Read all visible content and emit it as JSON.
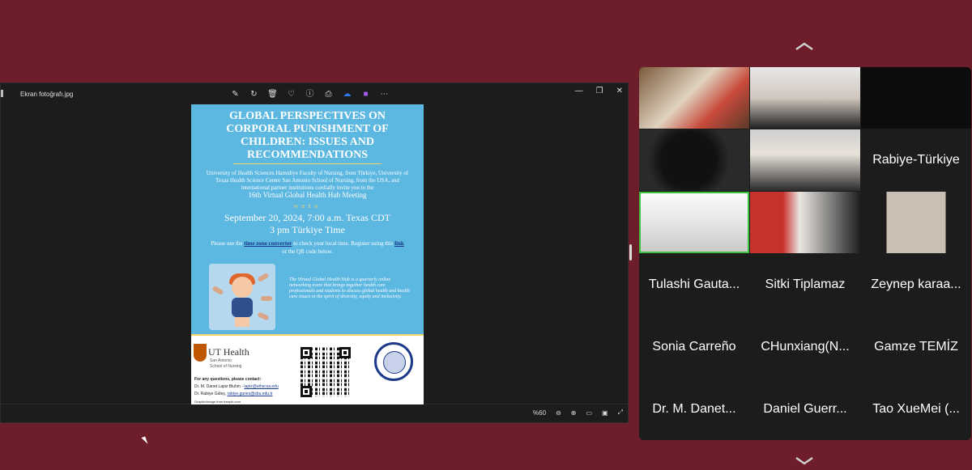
{
  "viewer": {
    "file_name": "Ekran fotoğrafı.jpg",
    "zoom": "%60",
    "toolbar_icons": [
      "edit-icon",
      "rotate-icon",
      "delete-icon",
      "favorite-icon",
      "info-icon",
      "print-icon",
      "onedrive-icon",
      "clipchamp-icon",
      "more-icon"
    ],
    "window_controls": [
      "minimize-icon",
      "maximize-icon",
      "close-icon"
    ]
  },
  "poster": {
    "title": "GLOBAL PERSPECTIVES ON CORPORAL PUNISHMENT OF CHILDREN: ISSUES AND RECOMMENDATIONS",
    "invite": "University of Health Sciences Hamidiye Faculty of Nursing, from Türkiye, University of Texas Health Science Center San Antonio School of Nursing, from the USA, and international partner institutions cordially invite you to the",
    "meeting": "16th Virtual Global Health Hub Meeting",
    "when": "WHEN",
    "date_line1": "September 20, 2024, 7:00 a.m. Texas CDT",
    "date_line2": "3 pm Türkiye Time",
    "note_pre": "Please use the",
    "note_link1": "time zone converter",
    "note_mid": "to check your local time. Register using this",
    "note_link2": "link",
    "note_post": "or the QR code below.",
    "hub_text": "The Virtual Global Health Hub is a quarterly online networking event that brings together health care professionals and students to discuss global health and health care issues in the spirit of diversity, equity and inclusivity.",
    "ut_name": "UT Health",
    "ut_sub1": "San Antonio",
    "ut_sub2": "School of Nursing",
    "contact_title": "For any questions, please contact:",
    "contact1_name": "Dr. M. Danet Lapiz Bluhm -",
    "contact1_email": "lapiz@uthscsa.edu",
    "contact2_name": "Dr. Rabiye Güleş,",
    "contact2_email": "rabiye.gunes@sbu.edu.tr",
    "credit": "Graphic/image from freepik.com"
  },
  "gallery": {
    "participants": [
      {
        "name": "",
        "video": true
      },
      {
        "name": "",
        "video": true
      },
      {
        "name": "",
        "video": true
      },
      {
        "name": "",
        "video": true
      },
      {
        "name": "",
        "video": true
      },
      {
        "name": "Rabiye-Türkiye",
        "video": false
      },
      {
        "name": "",
        "video": true
      },
      {
        "name": "",
        "video": true
      },
      {
        "name": "",
        "video": true
      },
      {
        "name": "Tulashi Gauta...",
        "video": false
      },
      {
        "name": "Sitki Tiplamaz",
        "video": false
      },
      {
        "name": "Zeynep karaa...",
        "video": false
      },
      {
        "name": "Sonia Carreño",
        "video": false
      },
      {
        "name": "CHunxiang(N...",
        "video": false
      },
      {
        "name": "Gamze TEMİZ",
        "video": false
      },
      {
        "name": "Dr. M. Danet...",
        "video": false
      },
      {
        "name": "Daniel Guerr...",
        "video": false
      },
      {
        "name": "Tao XueMei (...",
        "video": false
      }
    ]
  },
  "colors": {
    "background": "#6e1d2a",
    "active_speaker_border": "#3cc23c",
    "poster_blue": "#5cb7e1"
  }
}
